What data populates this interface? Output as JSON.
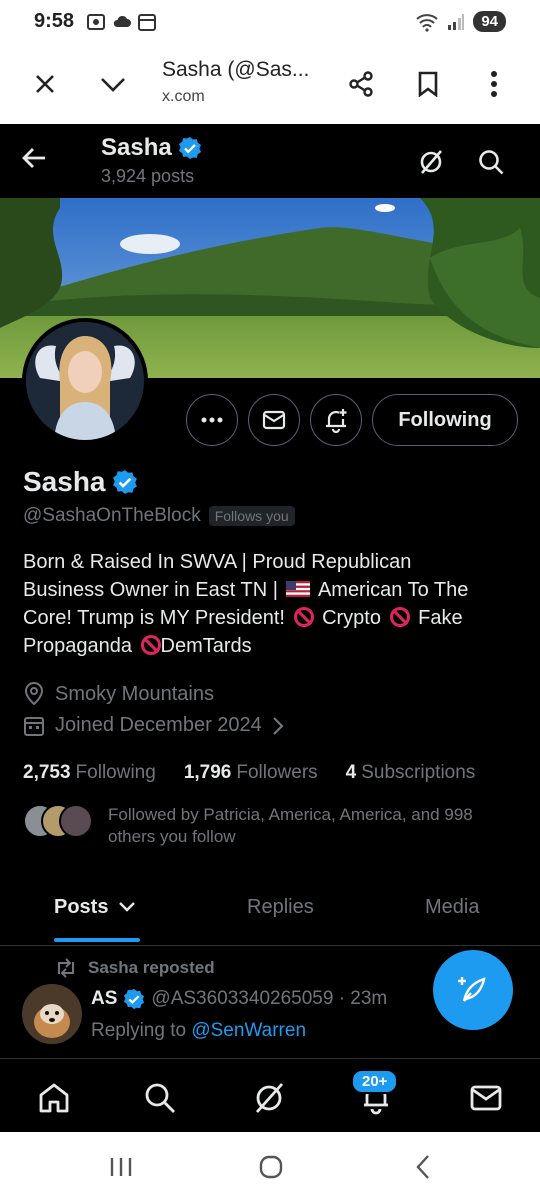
{
  "status_bar": {
    "time": "9:58",
    "battery": "94"
  },
  "browser": {
    "title": "Sasha (@Sas...",
    "url": "x.com"
  },
  "header": {
    "name": "Sasha",
    "posts_count": "3,924 posts"
  },
  "profile": {
    "name": "Sasha",
    "handle": "@SashaOnTheBlock",
    "follows_you": "Follows you",
    "follow_button": "Following",
    "bio": {
      "line1": "Born & Raised In SWVA | Proud Republican",
      "line2a": "Business Owner in East TN |",
      "line2b": "American To The",
      "line3a": "Core! Trump is MY President!",
      "line3b": "Crypto",
      "line3c": "Fake",
      "line4a": "Propaganda",
      "line4b": "DemTards"
    },
    "location": "Smoky Mountains",
    "joined": "Joined December 2024",
    "stats": {
      "following_count": "2,753",
      "following_label": "Following",
      "followers_count": "1,796",
      "followers_label": "Followers",
      "subscriptions_count": "4",
      "subscriptions_label": "Subscriptions"
    },
    "followed_by": "Followed by Patricia, America, America, and 998 others you follow"
  },
  "tabs": [
    {
      "label": "Posts"
    },
    {
      "label": "Replies"
    },
    {
      "label": "Media"
    }
  ],
  "post": {
    "repost_label": "Sasha reposted",
    "author": "AS",
    "handle_time": "@AS3603340265059 · 23m",
    "replying_prefix": "Replying to",
    "replying_to": "@SenWarren"
  },
  "bottom_nav": {
    "notifications_badge": "20+"
  },
  "colors": {
    "accent": "#1d9bf0",
    "background": "#000000",
    "muted": "#71767b",
    "text": "#e7e9ea"
  }
}
